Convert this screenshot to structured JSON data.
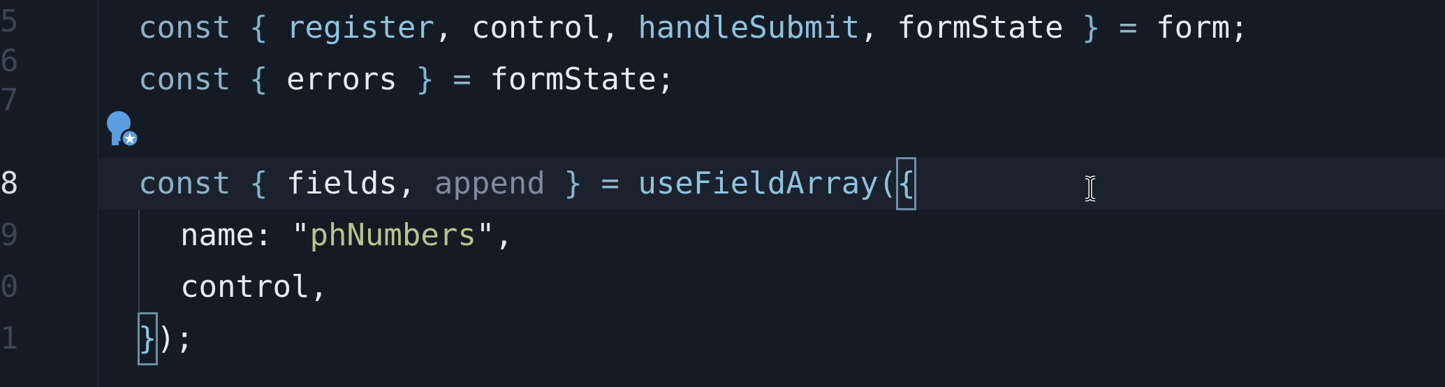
{
  "editor": {
    "colors": {
      "background": "#151b25",
      "current_line": "#1b222d",
      "keyword": "#8db1c6",
      "function": "#8fc3dd",
      "string": "#b8c48a",
      "dimmed_identifier": "#7d8aa0"
    },
    "line_numbers": [
      "5",
      "6",
      "7",
      "8",
      "9",
      "0",
      "1"
    ],
    "active_line_number": "8",
    "icons": {
      "lightbulb": "lightbulb-quickfix-icon",
      "text_cursor": "ibeam-cursor-icon"
    },
    "lines": {
      "l5": {
        "kw": "const",
        "open": "{",
        "a": "register",
        "c1": ",",
        "b": "control",
        "c2": ",",
        "c": "handleSubmit",
        "c3": ",",
        "d": "formState",
        "close": "}",
        "eq": "=",
        "rhs": "form",
        "semi": ";"
      },
      "l6": {
        "kw": "const",
        "open": "{",
        "a": "errors",
        "close": "}",
        "eq": "=",
        "rhs": "formState",
        "semi": ";"
      },
      "l8": {
        "kw": "const",
        "open": "{",
        "a": "fields",
        "c1": ",",
        "b": "append",
        "close": "}",
        "eq": "=",
        "fn": "useFieldArray",
        "paren": "(",
        "brace": "{"
      },
      "l9": {
        "key": "name:",
        "q1": "\"",
        "str": "phNumbers",
        "q2": "\"",
        "comma": ","
      },
      "l10": {
        "text": "control,"
      },
      "l11": {
        "brace": "}",
        "rest": ");"
      }
    }
  }
}
